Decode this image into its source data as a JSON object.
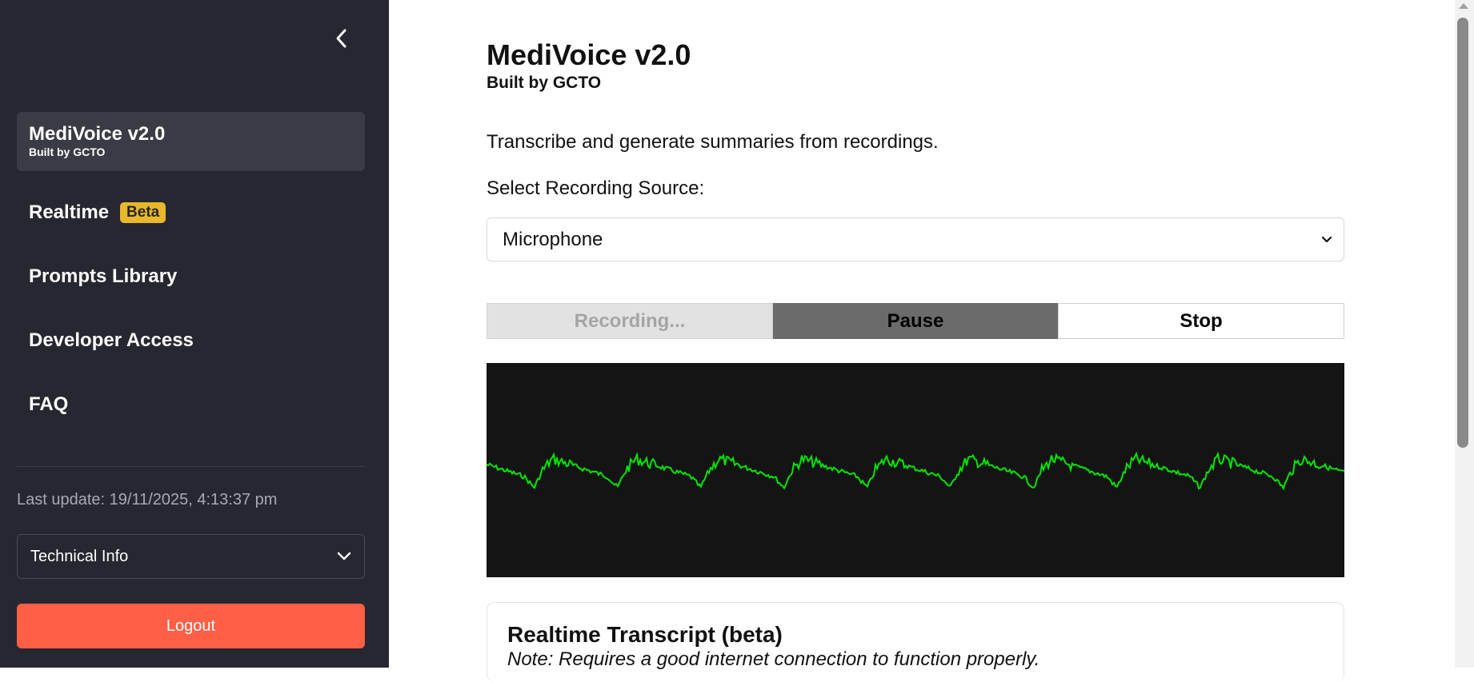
{
  "sidebar": {
    "brand": {
      "title": "MediVoice v2.0",
      "subtitle": "Built by GCTO"
    },
    "nav": [
      {
        "label": "Realtime",
        "badge": "Beta"
      },
      {
        "label": "Prompts Library"
      },
      {
        "label": "Developer Access"
      },
      {
        "label": "FAQ"
      }
    ],
    "last_update": "Last update: 19/11/2025, 4:13:37 pm",
    "tech_info": "Technical Info",
    "logout": "Logout"
  },
  "main": {
    "title": "MediVoice v2.0",
    "subtitle": "Built by GCTO",
    "description": "Transcribe and generate summaries from recordings.",
    "source_label": "Select Recording Source:",
    "source_value": "Microphone",
    "buttons": {
      "recording": "Recording...",
      "pause": "Pause",
      "stop": "Stop"
    },
    "transcript": {
      "title": "Realtime Transcript (beta)",
      "note": "Note: Requires a good internet connection to function properly."
    }
  },
  "colors": {
    "sidebar_bg": "#262730",
    "badge": "#e8b82a",
    "logout": "#ff5f45",
    "waveform_bg": "#141414",
    "waveform_line": "#00e600"
  },
  "icons": [
    "chevron-left-icon",
    "chevron-down-icon"
  ]
}
